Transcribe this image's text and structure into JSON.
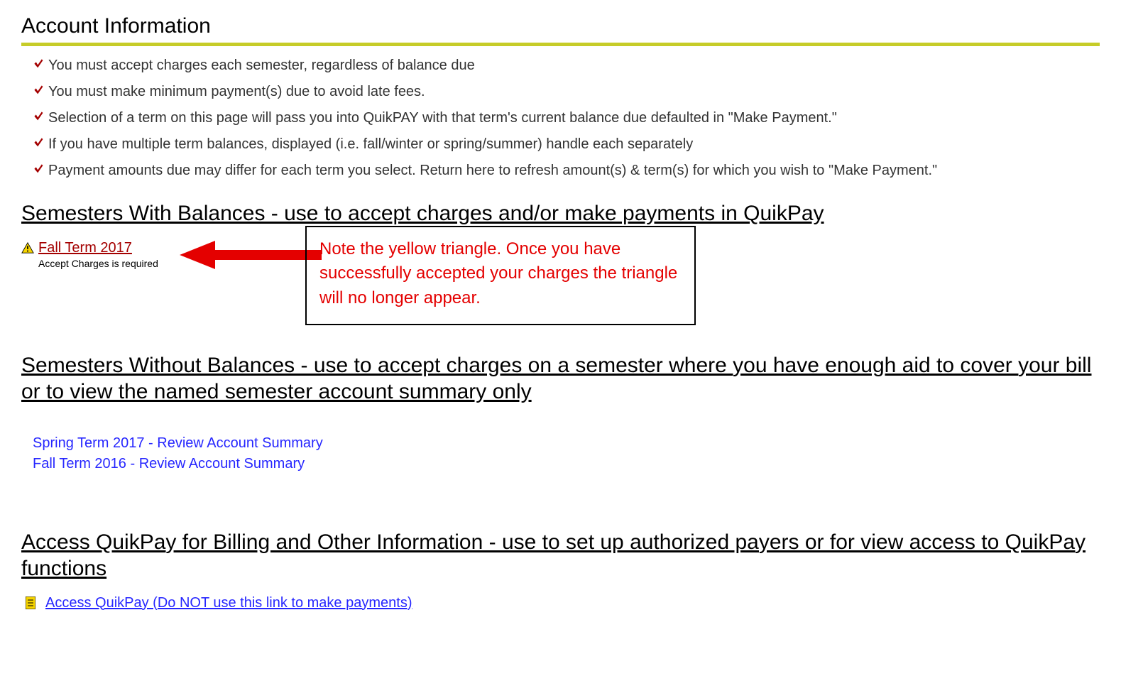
{
  "title": "Account Information",
  "bullets": [
    "You must accept charges each semester, regardless of balance due",
    "You must make minimum payment(s) due to avoid late fees.",
    "Selection of a term on this page will pass you into QuikPAY with that term's current balance due defaulted in \"Make Payment.\"",
    "If you have multiple term balances, displayed (i.e. fall/winter or spring/summer) handle each separately",
    "Payment amounts due may differ for each term you select. Return here to refresh amount(s) & term(s) for which you wish to \"Make Payment.\""
  ],
  "sections": {
    "with_balances_heading": "Semesters With Balances - use to accept charges and/or make payments in QuikPay",
    "without_balances_heading": "Semesters Without Balances - use to accept charges on a semester where you have enough aid to cover your bill or to view the named semester account summary only",
    "quikpay_heading": "Access QuikPay for Billing and Other Information - use to set up authorized payers or for view access to QuikPay functions"
  },
  "term_with_balance": {
    "label": "Fall Term 2017",
    "sub": "Accept Charges is required"
  },
  "note_box": "Note the yellow triangle. Once you have successfully accepted your charges the triangle will no longer appear.",
  "history_links": [
    "Spring Term 2017 - Review Account Summary",
    "Fall Term 2016 - Review Account Summary"
  ],
  "quikpay_link": "Access QuikPay (Do NOT use this link to make payments)"
}
